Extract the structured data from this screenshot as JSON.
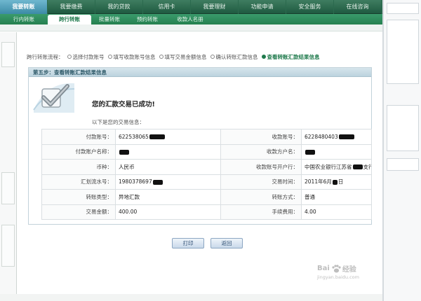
{
  "top_nav": {
    "tabs": [
      {
        "label": "我要转账"
      },
      {
        "label": "我要缴费"
      },
      {
        "label": "我的贷款"
      },
      {
        "label": "信用卡"
      },
      {
        "label": "我要理财"
      },
      {
        "label": "功能申请"
      },
      {
        "label": "安全服务"
      },
      {
        "label": "在线咨询"
      }
    ],
    "active_index": 0
  },
  "sub_nav": {
    "tabs": [
      {
        "label": "行内转账"
      },
      {
        "label": "跨行转账"
      },
      {
        "label": "批量转账"
      },
      {
        "label": "预约转账"
      },
      {
        "label": "收款人名册"
      }
    ],
    "active_index": 1
  },
  "flow": {
    "prefix": "跨行转账流程：",
    "steps": [
      "选择付款账号",
      "填写收款账号信息",
      "填写交易金额信息",
      "确认转账汇款信息",
      "查看转账汇款结果信息"
    ],
    "current_step": 5
  },
  "panel": {
    "step_title": "第五步：查看转账汇款结果信息",
    "success_message": "您的汇款交易已成功!",
    "intro": "以下是您的交易信息："
  },
  "details": {
    "payer_account": {
      "label": "付款账号：",
      "value": "622538065"
    },
    "payee_account": {
      "label": "收款账号：",
      "value": "6228480403"
    },
    "payer_name": {
      "label": "付款账户名称：",
      "value": ""
    },
    "payee_name": {
      "label": "收款方户名：",
      "value": ""
    },
    "currency": {
      "label": "币种：",
      "value": "人民币"
    },
    "payee_bank": {
      "label": "收款账号开户行：",
      "value": "中国农业银行江苏省",
      "suffix": "支行"
    },
    "serial_no": {
      "label": "汇划流水号：",
      "value": "1980378697"
    },
    "trade_time": {
      "label": "交易时间：",
      "value": "2011年6月",
      "suffix": "日"
    },
    "transfer_type": {
      "label": "转账类型：",
      "value": "异地汇款"
    },
    "transfer_mode": {
      "label": "转账方式：",
      "value": "普通"
    },
    "amount": {
      "label": "交易金额：",
      "value": "400.00"
    },
    "fee": {
      "label": "手续费用：",
      "value": "4.00"
    }
  },
  "buttons": {
    "print": "打印",
    "back": "返回"
  },
  "watermark": {
    "brand_left": "Bai",
    "brand_right": "经验",
    "url": "jingyan.baidu.com"
  },
  "icons": {
    "success": "checkmark-icon",
    "watermark": "paw-icon"
  },
  "colors": {
    "top_nav": "#1f5a41",
    "active_top_tab": "#3c8ba6",
    "sub_nav": "#25804f",
    "accent_green": "#1f7a4c",
    "panel_header": "#bcd3de",
    "redaction": "#111111"
  }
}
